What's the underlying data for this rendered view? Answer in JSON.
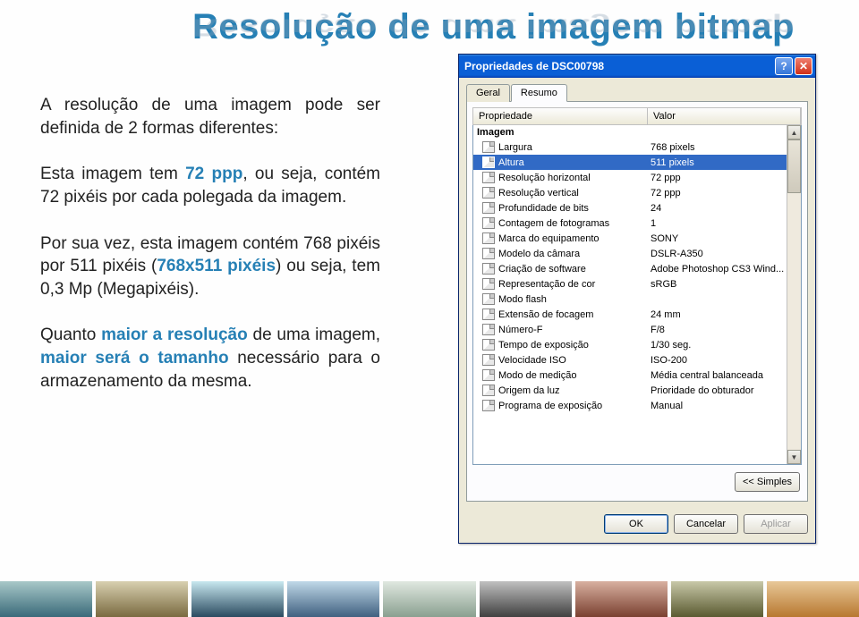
{
  "title": "Resolução de uma imagem bitmap",
  "paragraphs": {
    "p1_a": "A resolução de uma imagem pode ser definida de 2 formas diferentes:",
    "p2_a": "Esta imagem tem ",
    "p2_b": "72 ppp",
    "p2_c": ", ou seja, contém 72 pixéis por cada polegada da imagem.",
    "p3_a": "Por sua vez, esta imagem contém 768 pixéis por 511 pixéis (",
    "p3_b": "768x511 pixéis",
    "p3_c": ") ou seja, tem 0,3 Mp (Megapixéis).",
    "p4_a": "Quanto ",
    "p4_b": "maior a resolução",
    "p4_c": " de uma imagem, ",
    "p4_d": "maior será o tamanho",
    "p4_e": " necessário para o armazenamento da mesma."
  },
  "dialog": {
    "title": "Propriedades de DSC00798",
    "tabs": {
      "geral": "Geral",
      "resumo": "Resumo"
    },
    "headers": {
      "property": "Propriedade",
      "value": "Valor"
    },
    "group": "Imagem",
    "rows": [
      {
        "p": "Largura",
        "v": "768 pixels"
      },
      {
        "p": "Altura",
        "v": "511 pixels",
        "selected": true
      },
      {
        "p": "Resolução horizontal",
        "v": "72 ppp"
      },
      {
        "p": "Resolução vertical",
        "v": "72 ppp"
      },
      {
        "p": "Profundidade de bits",
        "v": "24"
      },
      {
        "p": "Contagem de fotogramas",
        "v": "1"
      },
      {
        "p": "Marca do equipamento",
        "v": "SONY"
      },
      {
        "p": "Modelo da câmara",
        "v": "DSLR-A350"
      },
      {
        "p": "Criação de software",
        "v": "Adobe Photoshop CS3 Wind..."
      },
      {
        "p": "Representação de cor",
        "v": "sRGB"
      },
      {
        "p": "Modo flash",
        "v": ""
      },
      {
        "p": "Extensão de focagem",
        "v": "24 mm"
      },
      {
        "p": "Número-F",
        "v": "F/8"
      },
      {
        "p": "Tempo de exposição",
        "v": "1/30 seg."
      },
      {
        "p": "Velocidade ISO",
        "v": "ISO-200"
      },
      {
        "p": "Modo de medição",
        "v": "Média central balanceada"
      },
      {
        "p": "Origem da luz",
        "v": "Prioridade do obturador"
      },
      {
        "p": "Programa de exposição",
        "v": "Manual"
      }
    ],
    "buttons": {
      "simples": "<< Simples",
      "ok": "OK",
      "cancel": "Cancelar",
      "apply": "Aplicar"
    }
  }
}
